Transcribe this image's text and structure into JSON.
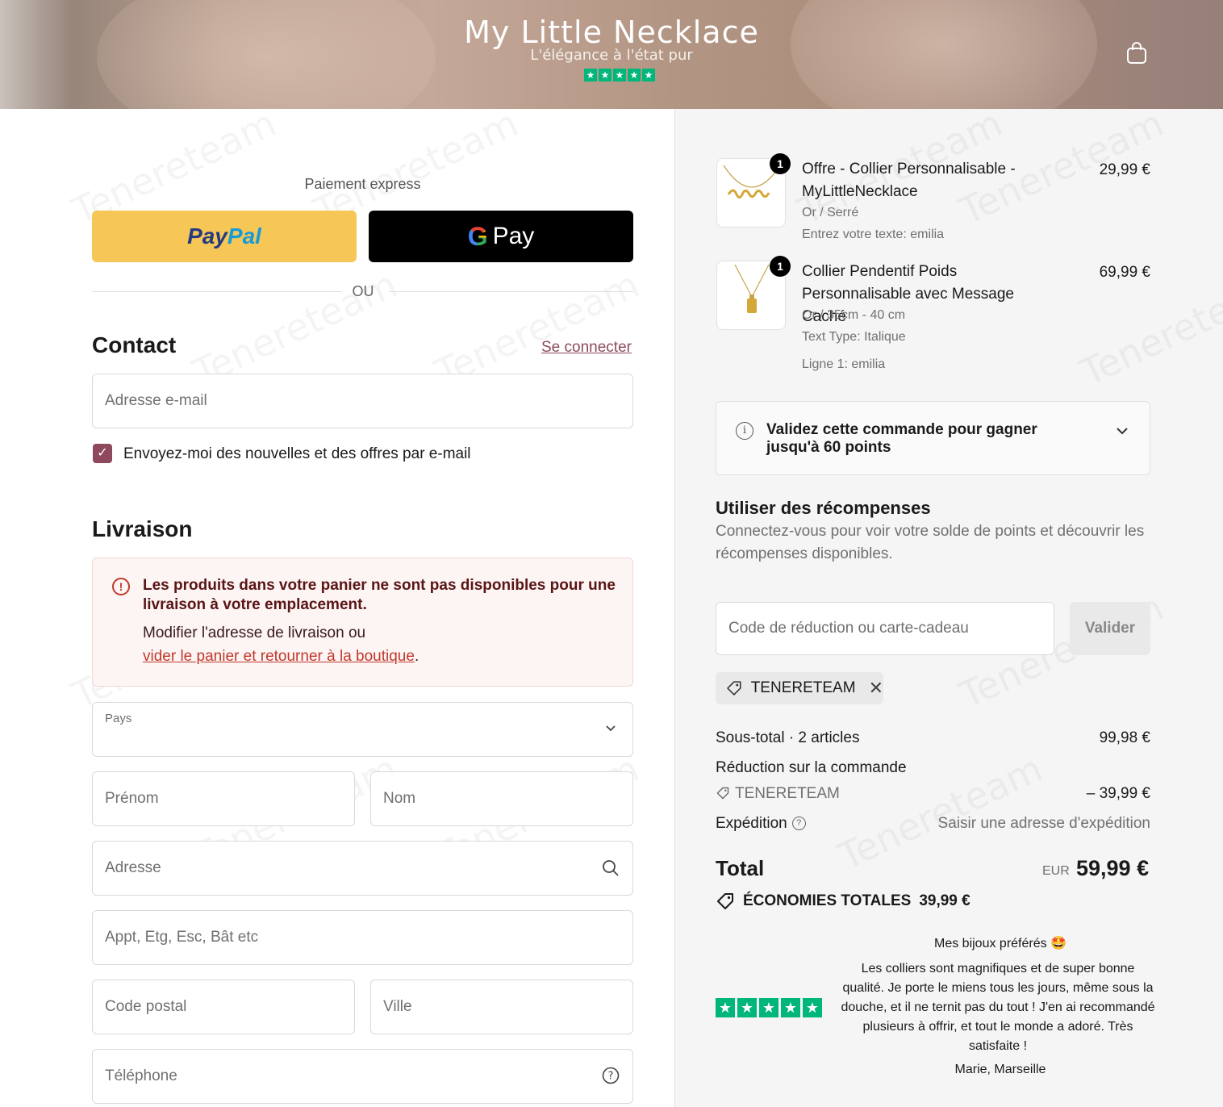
{
  "header": {
    "brand": "My Little Necklace",
    "tagline": "L'élégance à l'état pur",
    "rating_stars": 5
  },
  "express": {
    "label": "Paiement express",
    "paypal_pay": "Pay",
    "paypal_pal": "Pal",
    "gpay_g": "G",
    "gpay_label": "Pay",
    "divider": "OU"
  },
  "contact": {
    "heading": "Contact",
    "login": "Se connecter",
    "email_placeholder": "Adresse e-mail",
    "newsletter": "Envoyez-moi des nouvelles et des offres par e-mail",
    "newsletter_checked": true
  },
  "delivery": {
    "heading": "Livraison",
    "alert_title": "Les produits dans votre panier ne sont pas disponibles pour une livraison à votre emplacement.",
    "alert_text": "Modifier l'adresse de livraison ou",
    "alert_link": "vider le panier et retourner à la boutique",
    "alert_link_end": ".",
    "country_label": "Pays",
    "first_name": "Prénom",
    "last_name": "Nom",
    "address": "Adresse",
    "apartment": "Appt, Etg, Esc, Bât etc",
    "postal_code": "Code postal",
    "city": "Ville",
    "phone": "Téléphone"
  },
  "cart": {
    "items": [
      {
        "qty": "1",
        "title": "Offre - Collier Personnalisable - MyLittleNecklace",
        "meta": [
          "Or / Serré",
          "Entrez votre texte: emilia"
        ],
        "price": "29,99 €"
      },
      {
        "qty": "1",
        "title": "Collier Pendentif Poids Personnalisable avec Message Caché",
        "meta": [
          "Or / 35cm - 40 cm",
          "Text Type: Italique",
          "Ligne 1: emilia"
        ],
        "price": "69,99 €"
      }
    ],
    "points_text": "Validez cette commande pour gagner jusqu'à 60 points",
    "rewards_title": "Utiliser des récompenses",
    "rewards_text": "Connectez-vous pour voir votre solde de points et découvrir les récompenses disponibles.",
    "discount_placeholder": "Code de réduction ou carte-cadeau",
    "apply_label": "Valider",
    "applied_code": "TENERETEAM"
  },
  "summary": {
    "subtotal_label": "Sous-total · 2 articles",
    "subtotal_value": "99,98 €",
    "discount_label": "Réduction sur la commande",
    "discount_code": "TENERETEAM",
    "discount_value": "– 39,99 €",
    "shipping_label": "Expédition",
    "shipping_value": "Saisir une adresse d'expédition",
    "total_label": "Total",
    "currency": "EUR",
    "total_value": "59,99 €",
    "savings_label": "ÉCONOMIES TOTALES",
    "savings_value": "39,99 €"
  },
  "review": {
    "title": "Mes bijoux préférés 🤩",
    "text": "Les colliers sont magnifiques et de super bonne qualité. Je porte le miens tous les jours, même sous la douche, et il ne ternit pas du tout ! J'en ai recommandé plusieurs à offrir, et tout le monde a adoré. Très satisfaite !",
    "author": "Marie, Marseille",
    "stars": 5
  },
  "watermark": "Tenereteam",
  "colors": {
    "accent": "#8e4a5c",
    "paypal_yellow": "#f6c657",
    "trustpilot_green": "#00b67a",
    "alert_red": "#c0392b"
  }
}
